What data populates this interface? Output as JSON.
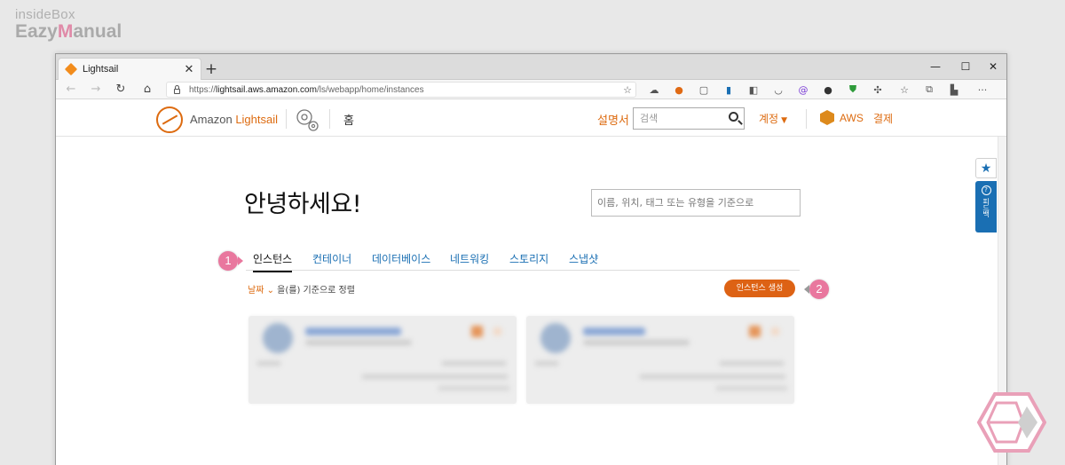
{
  "watermark": {
    "line1": "insideBox",
    "line2_prefix": "Eazy",
    "line2_hl": "M",
    "line2_suffix": "anual"
  },
  "browser": {
    "tab_title": "Lightsail",
    "tab_close": "✕",
    "new_tab": "+",
    "window_controls": {
      "minimize": "—",
      "maximize": "☐",
      "close": "✕"
    },
    "url_prefix": "https://",
    "url_host": "lightsail.aws.amazon.com",
    "url_path": "/ls/webapp/home/instances",
    "more": "···"
  },
  "header": {
    "brand_prefix": "Amazon ",
    "brand_accent": "Lightsail",
    "home": "홈",
    "docs": "설명서",
    "search_placeholder": "검색",
    "account": "계정",
    "aws": "AWS",
    "billing": "결제"
  },
  "main": {
    "greeting": "안녕하세요!",
    "filter_placeholder": "이름, 위치, 태그 또는 유형을 기준으로",
    "tabs": [
      "인스턴스",
      "컨테이너",
      "데이터베이스",
      "네트워킹",
      "스토리지",
      "스냅샷"
    ],
    "sort_key": "날짜",
    "sort_caret": "⌄",
    "sort_suffix": "을(를) 기준으로 정렬",
    "create_button": "인스턴스 생성"
  },
  "callouts": {
    "one": "1",
    "two": "2"
  },
  "side_widget": {
    "star": "★",
    "q": "?",
    "feedback": "피드백"
  },
  "colors": {
    "accent": "#dd6b10",
    "link": "#1a6fb3",
    "callout": "#e9779e"
  }
}
